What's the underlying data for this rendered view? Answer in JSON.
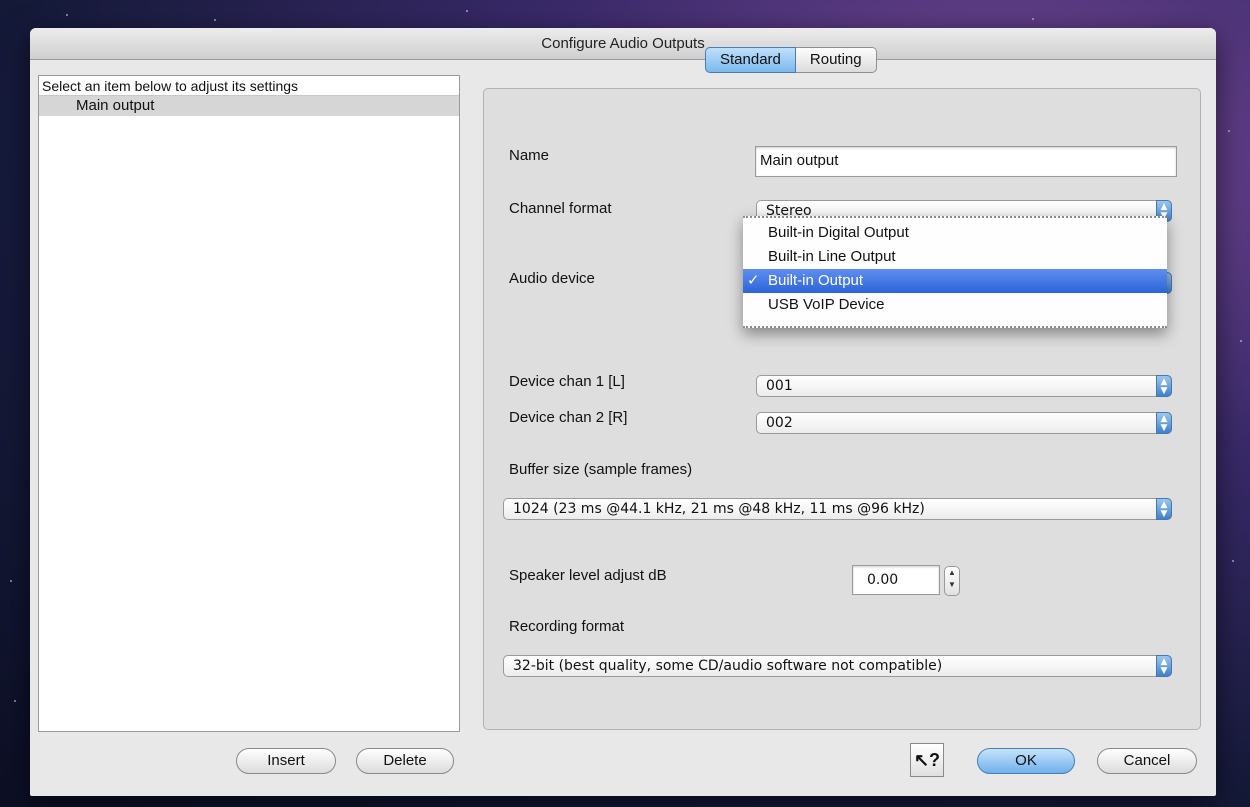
{
  "window": {
    "title": "Configure Audio Outputs"
  },
  "list": {
    "header": "Select an item below to adjust its settings",
    "items": [
      "Main output"
    ]
  },
  "tabs": [
    "Standard",
    "Routing"
  ],
  "form": {
    "name_label": "Name",
    "name_value": "Main output",
    "channel_format_label": "Channel format",
    "channel_format_value": "Stereo",
    "audio_device_label": "Audio device",
    "device_chan1_label": "Device chan 1 [L]",
    "device_chan1_value": "001",
    "device_chan2_label": "Device chan 2 [R]",
    "device_chan2_value": "002",
    "buffer_label": "Buffer size (sample frames)",
    "buffer_value": "1024 (23 ms @44.1 kHz, 21 ms @48 kHz, 11 ms @96 kHz)",
    "speaker_label": "Speaker level adjust dB",
    "speaker_value": "0.00",
    "recording_label": "Recording format",
    "recording_value": "32-bit (best quality, some CD/audio software not compatible)"
  },
  "audio_device_menu": {
    "items": [
      "Built-in Digital Output",
      "Built-in Line Output",
      "Built-in Output",
      "USB VoIP Device"
    ],
    "selected": "Built-in Output",
    "check": "✓"
  },
  "buttons": {
    "insert": "Insert",
    "delete": "Delete",
    "help": "?",
    "ok": "OK",
    "cancel": "Cancel"
  },
  "icons": {
    "help": "help-pointer-icon",
    "popup_arrows": "up-down-arrows-icon"
  },
  "colors": {
    "accent": "#3d80cc",
    "selection": "#2e63d8"
  }
}
